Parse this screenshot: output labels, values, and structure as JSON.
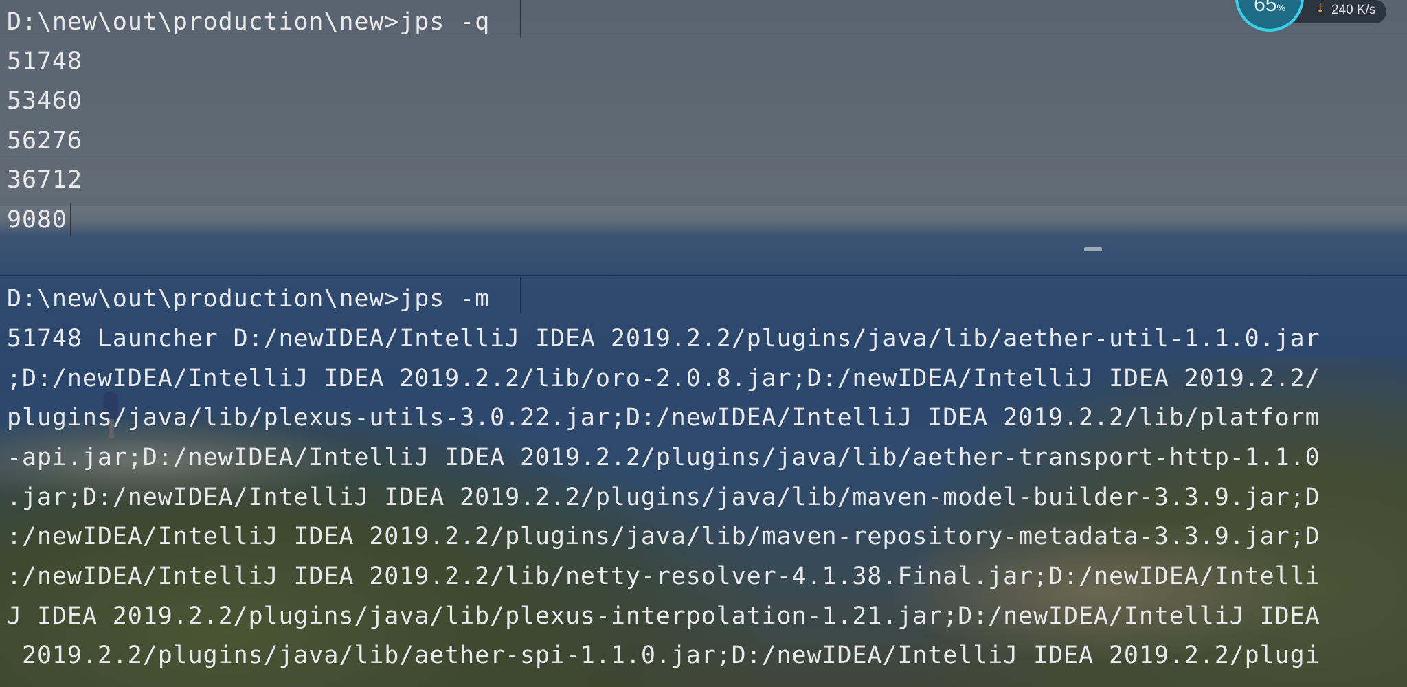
{
  "terminal": {
    "lines": [
      "D:\\new\\out\\production\\new>jps -q",
      "51748",
      "53460",
      "56276",
      "36712",
      "9080",
      "",
      "D:\\new\\out\\production\\new>jps -m",
      "51748 Launcher D:/newIDEA/IntelliJ IDEA 2019.2.2/plugins/java/lib/aether-util-1.1.0.jar",
      ";D:/newIDEA/IntelliJ IDEA 2019.2.2/lib/oro-2.0.8.jar;D:/newIDEA/IntelliJ IDEA 2019.2.2/",
      "plugins/java/lib/plexus-utils-3.0.22.jar;D:/newIDEA/IntelliJ IDEA 2019.2.2/lib/platform",
      "-api.jar;D:/newIDEA/IntelliJ IDEA 2019.2.2/plugins/java/lib/aether-transport-http-1.1.0",
      ".jar;D:/newIDEA/IntelliJ IDEA 2019.2.2/plugins/java/lib/maven-model-builder-3.3.9.jar;D",
      ":/newIDEA/IntelliJ IDEA 2019.2.2/plugins/java/lib/maven-repository-metadata-3.3.9.jar;D",
      ":/newIDEA/IntelliJ IDEA 2019.2.2/lib/netty-resolver-4.1.38.Final.jar;D:/newIDEA/Intelli",
      "J IDEA 2019.2.2/plugins/java/lib/plexus-interpolation-1.21.jar;D:/newIDEA/IntelliJ IDEA",
      " 2019.2.2/plugins/java/lib/aether-spi-1.1.0.jar;D:/newIDEA/IntelliJ IDEA 2019.2.2/plugi"
    ]
  },
  "net_widget": {
    "percent_text": "65",
    "percent_suffix": "%",
    "download_speed": "240 K/s",
    "arrow_icon": "download-arrow-icon",
    "ring_color": "#3ad0e6",
    "arrow_color": "#f0a640"
  }
}
